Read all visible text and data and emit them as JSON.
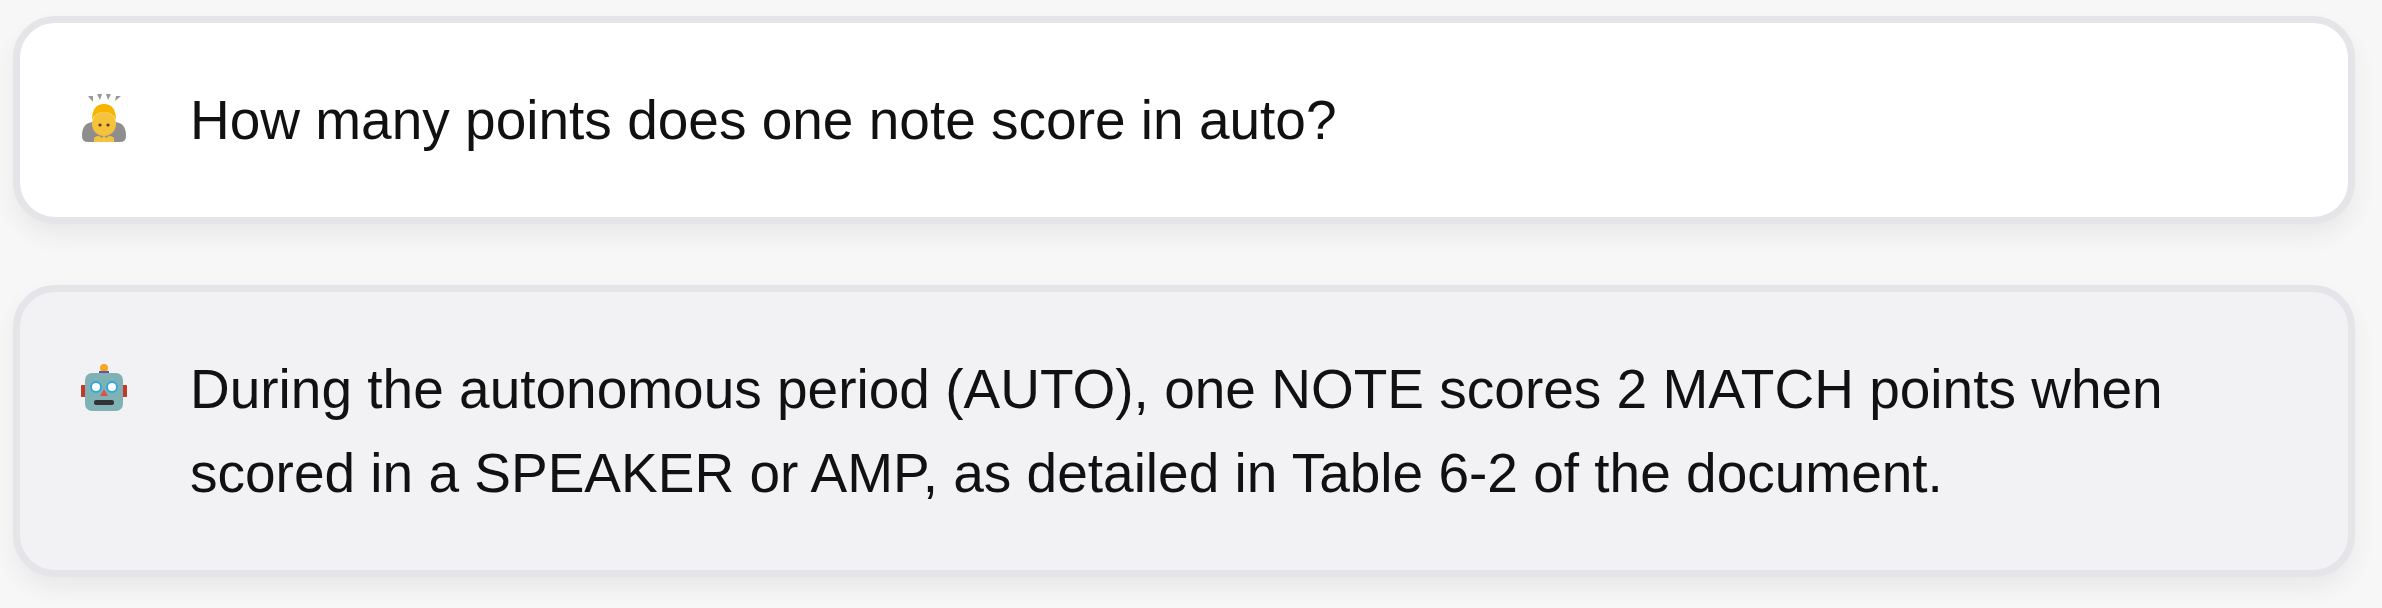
{
  "messages": [
    {
      "kind": "user",
      "text": "How many points does one note score in auto?"
    },
    {
      "kind": "assistant",
      "text": "During the autonomous period (AUTO), one NOTE scores 2 MATCH points when scored in a SPEAKER or AMP, as detailed in Table 6-2 of the document."
    }
  ]
}
